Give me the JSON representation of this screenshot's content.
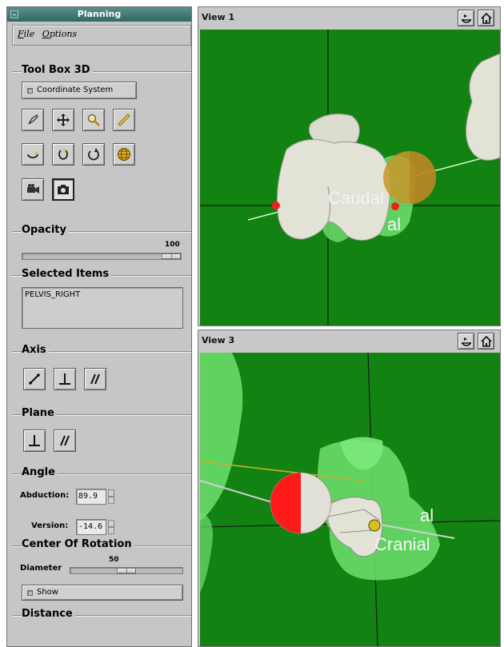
{
  "panel": {
    "title": "Planning",
    "menu": [
      "File",
      "Options"
    ]
  },
  "toolbox": {
    "title": "Tool Box 3D",
    "coordinate_label": "Coordinate System",
    "tools": [
      "pick-tool-icon",
      "move-icon",
      "zoom-icon",
      "ruler-icon",
      "rotate-left-icon",
      "rotate-back-icon",
      "rotate-right-icon",
      "globe-icon",
      "video-camera-icon",
      "photo-camera-icon"
    ]
  },
  "opacity": {
    "title": "Opacity",
    "value": "100",
    "level": 1.0
  },
  "selected": {
    "title": "Selected Items",
    "items": [
      "PELVIS_RIGHT"
    ]
  },
  "axis": {
    "title": "Axis",
    "buttons": [
      "line-icon",
      "perpendicular-icon",
      "parallel-icon"
    ]
  },
  "plane": {
    "title": "Plane",
    "buttons": [
      "perpendicular-icon",
      "parallel-icon"
    ]
  },
  "angle": {
    "title": "Angle",
    "abduction_label": "Abduction:",
    "abduction_value": "89.9",
    "version_label": "Version:",
    "version_value": "-14.6"
  },
  "cor": {
    "title": "Center Of Rotation",
    "diameter_label": "Diameter",
    "diameter_value": "50",
    "diameter_level": 0.5,
    "show_label": "Show"
  },
  "distance": {
    "title": "Distance"
  },
  "views": [
    {
      "title": "View 1",
      "labels": [
        "Caudal",
        "al"
      ]
    },
    {
      "title": "View 3",
      "labels": [
        "al",
        "Cranial"
      ]
    }
  ],
  "colors": {
    "viewport_bg": "#128212",
    "bone": "#dcdcd0",
    "translucent_green": "#6fe06f",
    "red_marker": "#ff2020",
    "header": "#3a7572"
  }
}
